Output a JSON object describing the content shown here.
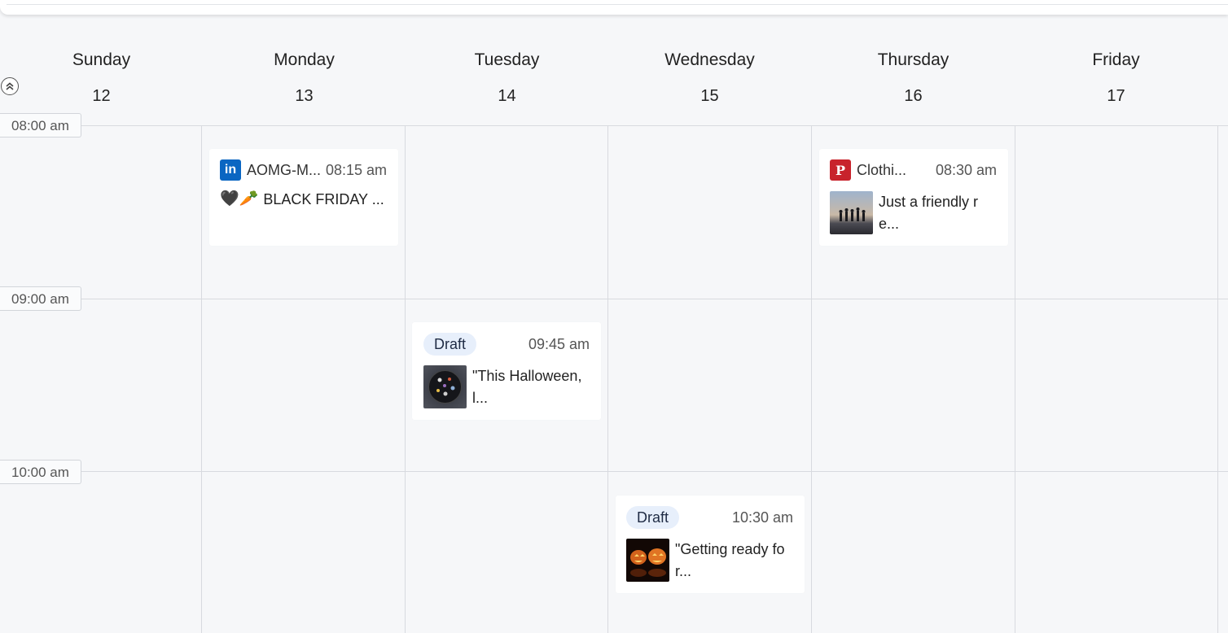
{
  "calendar": {
    "days": [
      {
        "name": "Sunday",
        "date": "12"
      },
      {
        "name": "Monday",
        "date": "13"
      },
      {
        "name": "Tuesday",
        "date": "14"
      },
      {
        "name": "Wednesday",
        "date": "15"
      },
      {
        "name": "Thursday",
        "date": "16"
      },
      {
        "name": "Friday",
        "date": "17"
      }
    ],
    "time_slots": [
      "08:00 am",
      "09:00 am",
      "10:00 am"
    ]
  },
  "posts": [
    {
      "day": "Monday",
      "network": "linkedin-icon",
      "account": "AOMG-M...",
      "time": "08:15 am",
      "text": "BLACK FRIDAY ...",
      "emoji": "🖤🥕"
    },
    {
      "day": "Thursday",
      "network": "pinterest-icon",
      "account": "Clothi...",
      "time": "08:30 am",
      "text": "Just a friendly r e..."
    },
    {
      "day": "Tuesday",
      "status": "Draft",
      "time": "09:45 am",
      "text": "\"This Halloween, l..."
    },
    {
      "day": "Wednesday",
      "status": "Draft",
      "time": "10:30 am",
      "text": "\"Getting ready fo r..."
    }
  ],
  "colors": {
    "linkedin": "#0a66c2",
    "pinterest": "#c8232c",
    "draft_bg": "#e7effb"
  }
}
